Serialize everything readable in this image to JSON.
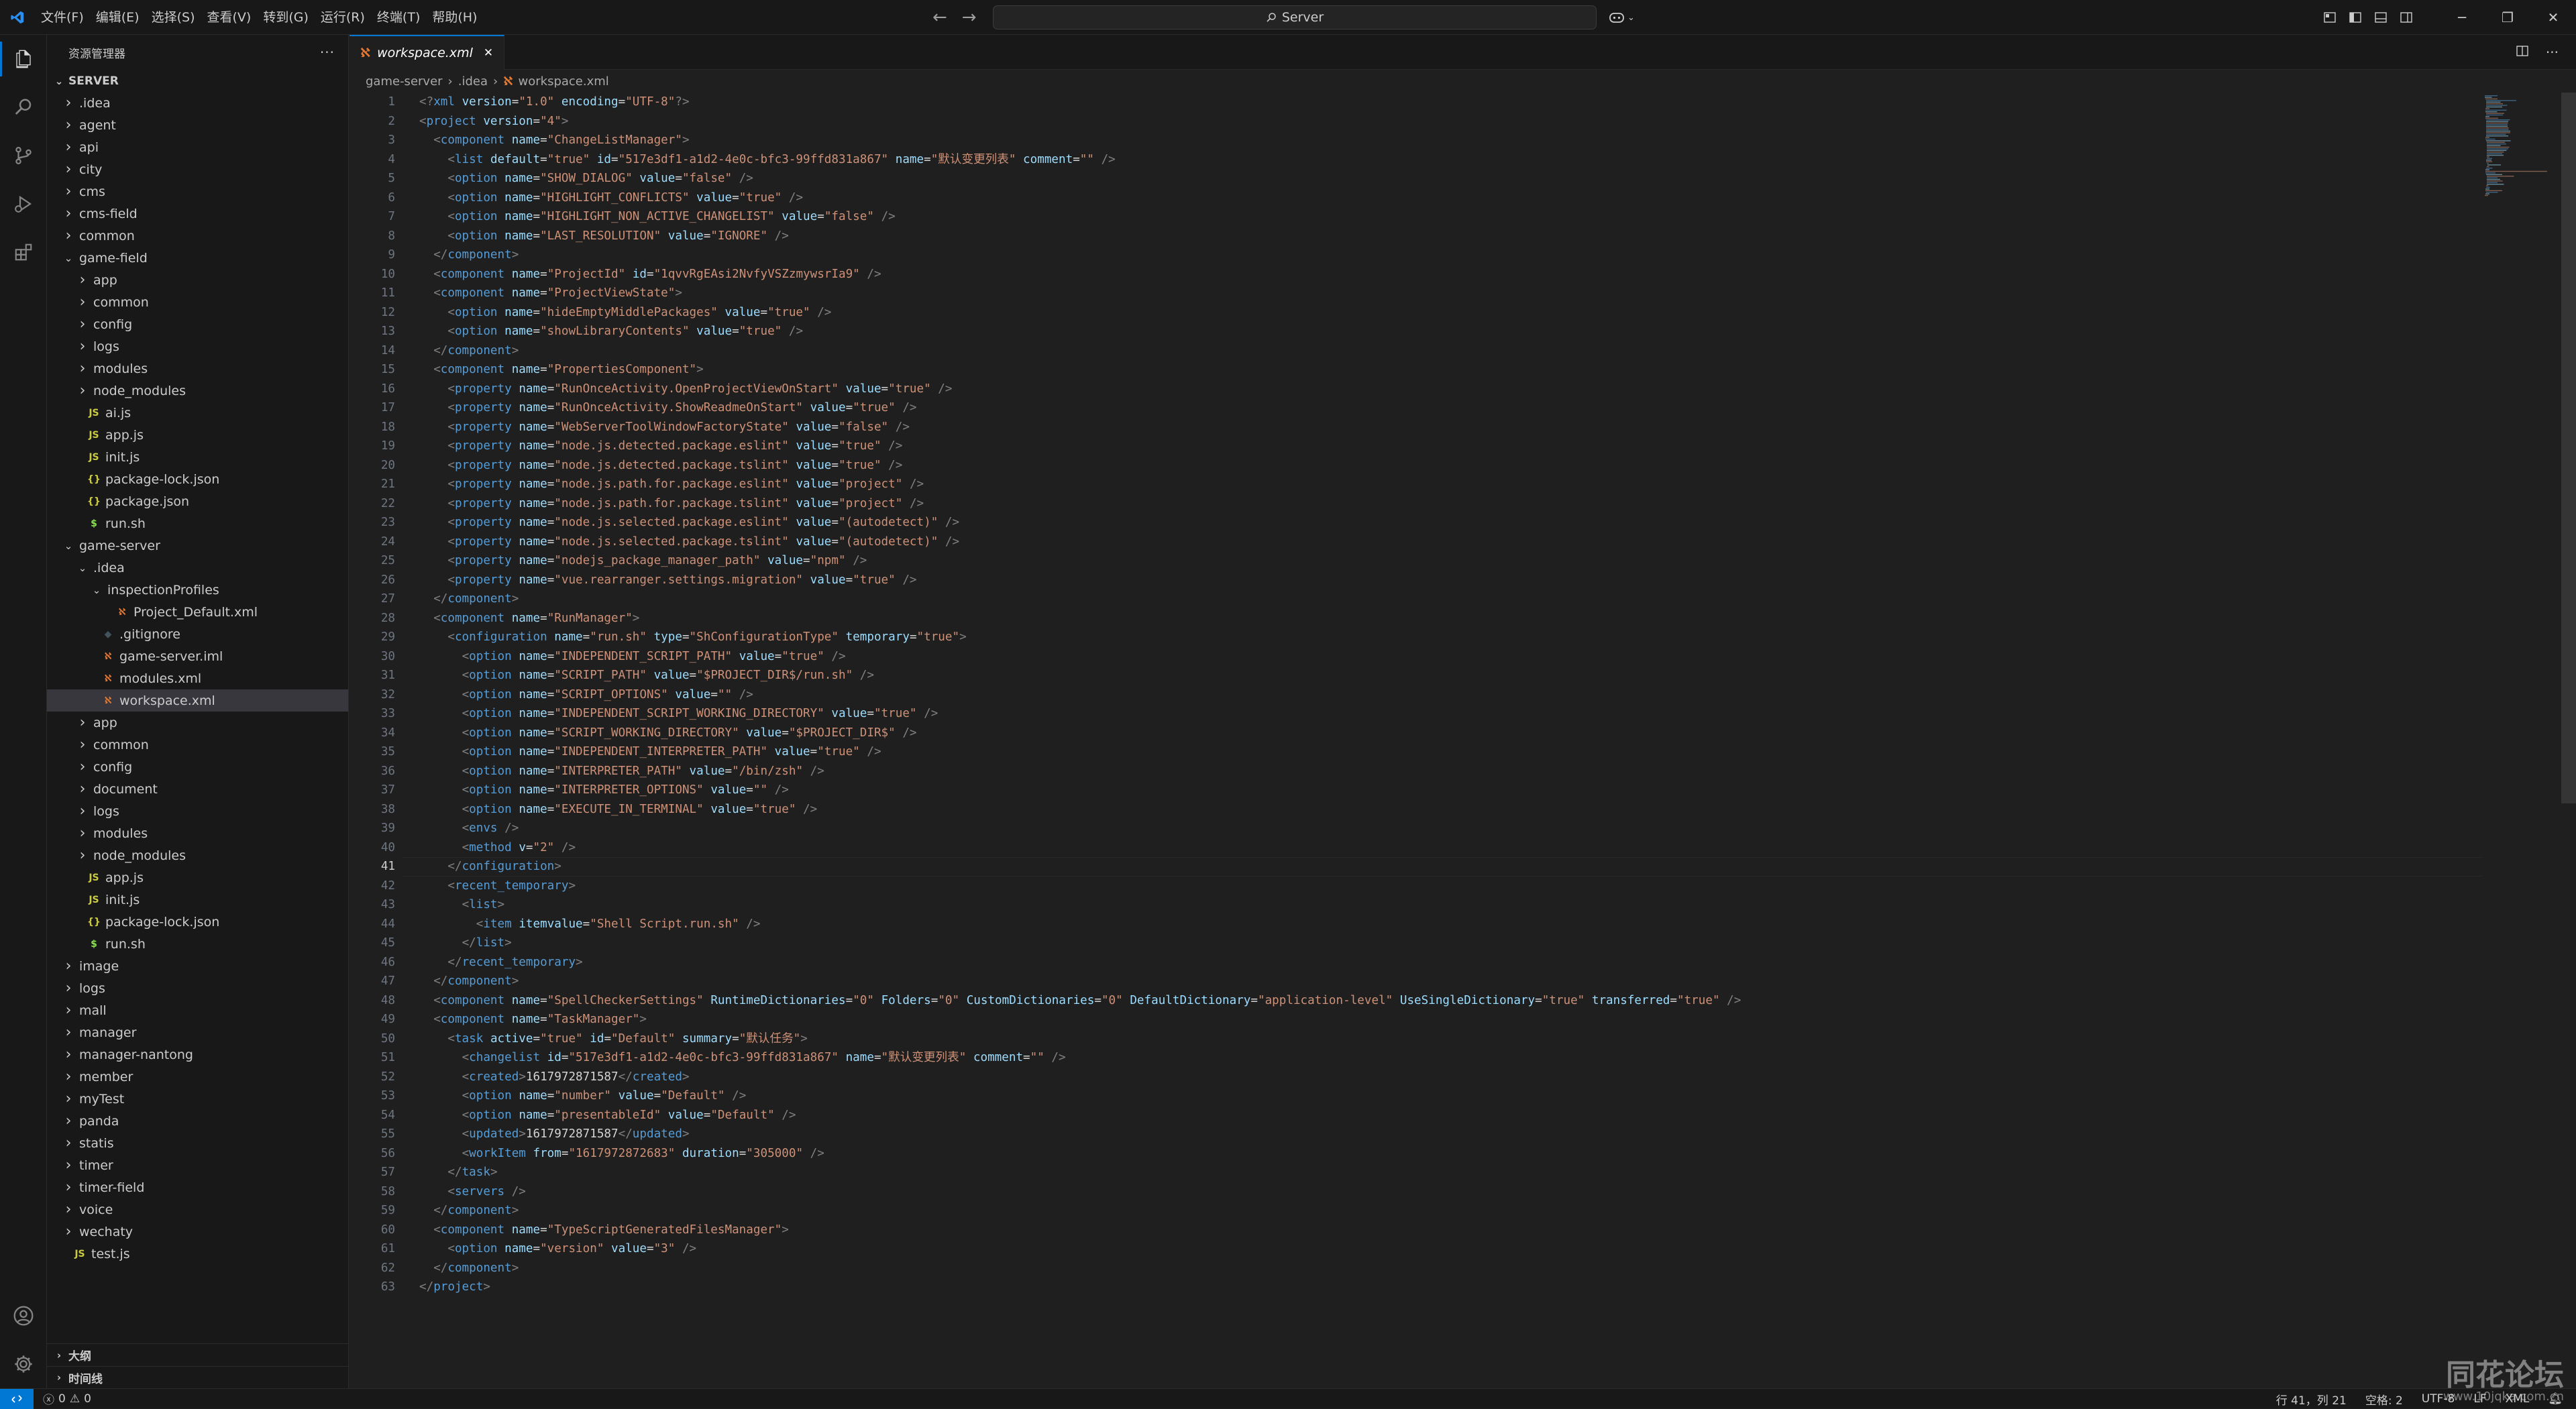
{
  "menu": [
    "文件(F)",
    "编辑(E)",
    "选择(S)",
    "查看(V)",
    "转到(G)",
    "运行(R)",
    "终端(T)",
    "帮助(H)"
  ],
  "search": {
    "text": "Server"
  },
  "sidebar": {
    "title": "资源管理器",
    "root": "SERVER",
    "items": [
      {
        "depth": 0,
        "type": "folder",
        "open": false,
        "label": ".idea"
      },
      {
        "depth": 0,
        "type": "folder",
        "open": false,
        "label": "agent"
      },
      {
        "depth": 0,
        "type": "folder",
        "open": false,
        "label": "api"
      },
      {
        "depth": 0,
        "type": "folder",
        "open": false,
        "label": "city"
      },
      {
        "depth": 0,
        "type": "folder",
        "open": false,
        "label": "cms"
      },
      {
        "depth": 0,
        "type": "folder",
        "open": false,
        "label": "cms-field"
      },
      {
        "depth": 0,
        "type": "folder",
        "open": false,
        "label": "common"
      },
      {
        "depth": 0,
        "type": "folder",
        "open": true,
        "label": "game-field"
      },
      {
        "depth": 1,
        "type": "folder",
        "open": false,
        "label": "app"
      },
      {
        "depth": 1,
        "type": "folder",
        "open": false,
        "label": "common"
      },
      {
        "depth": 1,
        "type": "folder",
        "open": false,
        "label": "config"
      },
      {
        "depth": 1,
        "type": "folder",
        "open": false,
        "label": "logs"
      },
      {
        "depth": 1,
        "type": "folder",
        "open": false,
        "label": "modules"
      },
      {
        "depth": 1,
        "type": "folder",
        "open": false,
        "label": "node_modules"
      },
      {
        "depth": 1,
        "type": "js",
        "label": "ai.js"
      },
      {
        "depth": 1,
        "type": "js",
        "label": "app.js"
      },
      {
        "depth": 1,
        "type": "js",
        "label": "init.js"
      },
      {
        "depth": 1,
        "type": "json",
        "label": "package-lock.json"
      },
      {
        "depth": 1,
        "type": "json",
        "label": "package.json"
      },
      {
        "depth": 1,
        "type": "sh",
        "label": "run.sh"
      },
      {
        "depth": 0,
        "type": "folder",
        "open": true,
        "label": "game-server"
      },
      {
        "depth": 1,
        "type": "folder",
        "open": true,
        "label": ".idea"
      },
      {
        "depth": 2,
        "type": "folder",
        "open": true,
        "label": "inspectionProfiles"
      },
      {
        "depth": 3,
        "type": "xml",
        "label": "Project_Default.xml"
      },
      {
        "depth": 2,
        "type": "git",
        "label": ".gitignore"
      },
      {
        "depth": 2,
        "type": "xml",
        "label": "game-server.iml"
      },
      {
        "depth": 2,
        "type": "xml",
        "label": "modules.xml"
      },
      {
        "depth": 2,
        "type": "xml",
        "label": "workspace.xml",
        "selected": true
      },
      {
        "depth": 1,
        "type": "folder",
        "open": false,
        "label": "app"
      },
      {
        "depth": 1,
        "type": "folder",
        "open": false,
        "label": "common"
      },
      {
        "depth": 1,
        "type": "folder",
        "open": false,
        "label": "config"
      },
      {
        "depth": 1,
        "type": "folder",
        "open": false,
        "label": "document"
      },
      {
        "depth": 1,
        "type": "folder",
        "open": false,
        "label": "logs"
      },
      {
        "depth": 1,
        "type": "folder",
        "open": false,
        "label": "modules"
      },
      {
        "depth": 1,
        "type": "folder",
        "open": false,
        "label": "node_modules"
      },
      {
        "depth": 1,
        "type": "js",
        "label": "app.js"
      },
      {
        "depth": 1,
        "type": "js",
        "label": "init.js"
      },
      {
        "depth": 1,
        "type": "json",
        "label": "package-lock.json"
      },
      {
        "depth": 1,
        "type": "sh",
        "label": "run.sh"
      },
      {
        "depth": 0,
        "type": "folder",
        "open": false,
        "label": "image"
      },
      {
        "depth": 0,
        "type": "folder",
        "open": false,
        "label": "logs"
      },
      {
        "depth": 0,
        "type": "folder",
        "open": false,
        "label": "mall"
      },
      {
        "depth": 0,
        "type": "folder",
        "open": false,
        "label": "manager"
      },
      {
        "depth": 0,
        "type": "folder",
        "open": false,
        "label": "manager-nantong"
      },
      {
        "depth": 0,
        "type": "folder",
        "open": false,
        "label": "member"
      },
      {
        "depth": 0,
        "type": "folder",
        "open": false,
        "label": "myTest"
      },
      {
        "depth": 0,
        "type": "folder",
        "open": false,
        "label": "panda"
      },
      {
        "depth": 0,
        "type": "folder",
        "open": false,
        "label": "statis"
      },
      {
        "depth": 0,
        "type": "folder",
        "open": false,
        "label": "timer"
      },
      {
        "depth": 0,
        "type": "folder",
        "open": false,
        "label": "timer-field"
      },
      {
        "depth": 0,
        "type": "folder",
        "open": false,
        "label": "voice"
      },
      {
        "depth": 0,
        "type": "folder",
        "open": false,
        "label": "wechaty"
      },
      {
        "depth": 0,
        "type": "js",
        "label": "test.js"
      }
    ],
    "outline_label": "大纲",
    "timeline_label": "时间线"
  },
  "tab": {
    "label": "workspace.xml"
  },
  "breadcrumb": [
    "game-server",
    ".idea",
    "workspace.xml"
  ],
  "editor": {
    "cursor_line": 41,
    "lines": [
      "<?xml version=\"1.0\" encoding=\"UTF-8\"?>",
      "<project version=\"4\">",
      "  <component name=\"ChangeListManager\">",
      "    <list default=\"true\" id=\"517e3df1-a1d2-4e0c-bfc3-99ffd831a867\" name=\"默认变更列表\" comment=\"\" />",
      "    <option name=\"SHOW_DIALOG\" value=\"false\" />",
      "    <option name=\"HIGHLIGHT_CONFLICTS\" value=\"true\" />",
      "    <option name=\"HIGHLIGHT_NON_ACTIVE_CHANGELIST\" value=\"false\" />",
      "    <option name=\"LAST_RESOLUTION\" value=\"IGNORE\" />",
      "  </component>",
      "  <component name=\"ProjectId\" id=\"1qvvRgEAsi2NvfyVSZzmywsrIa9\" />",
      "  <component name=\"ProjectViewState\">",
      "    <option name=\"hideEmptyMiddlePackages\" value=\"true\" />",
      "    <option name=\"showLibraryContents\" value=\"true\" />",
      "  </component>",
      "  <component name=\"PropertiesComponent\">",
      "    <property name=\"RunOnceActivity.OpenProjectViewOnStart\" value=\"true\" />",
      "    <property name=\"RunOnceActivity.ShowReadmeOnStart\" value=\"true\" />",
      "    <property name=\"WebServerToolWindowFactoryState\" value=\"false\" />",
      "    <property name=\"node.js.detected.package.eslint\" value=\"true\" />",
      "    <property name=\"node.js.detected.package.tslint\" value=\"true\" />",
      "    <property name=\"node.js.path.for.package.eslint\" value=\"project\" />",
      "    <property name=\"node.js.path.for.package.tslint\" value=\"project\" />",
      "    <property name=\"node.js.selected.package.eslint\" value=\"(autodetect)\" />",
      "    <property name=\"node.js.selected.package.tslint\" value=\"(autodetect)\" />",
      "    <property name=\"nodejs_package_manager_path\" value=\"npm\" />",
      "    <property name=\"vue.rearranger.settings.migration\" value=\"true\" />",
      "  </component>",
      "  <component name=\"RunManager\">",
      "    <configuration name=\"run.sh\" type=\"ShConfigurationType\" temporary=\"true\">",
      "      <option name=\"INDEPENDENT_SCRIPT_PATH\" value=\"true\" />",
      "      <option name=\"SCRIPT_PATH\" value=\"$PROJECT_DIR$/run.sh\" />",
      "      <option name=\"SCRIPT_OPTIONS\" value=\"\" />",
      "      <option name=\"INDEPENDENT_SCRIPT_WORKING_DIRECTORY\" value=\"true\" />",
      "      <option name=\"SCRIPT_WORKING_DIRECTORY\" value=\"$PROJECT_DIR$\" />",
      "      <option name=\"INDEPENDENT_INTERPRETER_PATH\" value=\"true\" />",
      "      <option name=\"INTERPRETER_PATH\" value=\"/bin/zsh\" />",
      "      <option name=\"INTERPRETER_OPTIONS\" value=\"\" />",
      "      <option name=\"EXECUTE_IN_TERMINAL\" value=\"true\" />",
      "      <envs />",
      "      <method v=\"2\" />",
      "    </configuration>",
      "    <recent_temporary>",
      "      <list>",
      "        <item itemvalue=\"Shell Script.run.sh\" />",
      "      </list>",
      "    </recent_temporary>",
      "  </component>",
      "  <component name=\"SpellCheckerSettings\" RuntimeDictionaries=\"0\" Folders=\"0\" CustomDictionaries=\"0\" DefaultDictionary=\"application-level\" UseSingleDictionary=\"true\" transferred=\"true\" />",
      "  <component name=\"TaskManager\">",
      "    <task active=\"true\" id=\"Default\" summary=\"默认任务\">",
      "      <changelist id=\"517e3df1-a1d2-4e0c-bfc3-99ffd831a867\" name=\"默认变更列表\" comment=\"\" />",
      "      <created>1617972871587</created>",
      "      <option name=\"number\" value=\"Default\" />",
      "      <option name=\"presentableId\" value=\"Default\" />",
      "      <updated>1617972871587</updated>",
      "      <workItem from=\"1617972872683\" duration=\"305000\" />",
      "    </task>",
      "    <servers />",
      "  </component>",
      "  <component name=\"TypeScriptGeneratedFilesManager\">",
      "    <option name=\"version\" value=\"3\" />",
      "  </component>",
      "</project>"
    ]
  },
  "status": {
    "errors": "0",
    "warnings": "0",
    "position": "行 41，列 21",
    "spaces": "空格: 2",
    "encoding": "UTF-8",
    "eol": "LF",
    "language": "XML"
  },
  "watermark": {
    "title": "同花论坛",
    "url": "www.10jqka.com.cn"
  },
  "colors": {
    "accent": "#0078d4",
    "tag": "#569cd6",
    "attr": "#9cdcfe",
    "string": "#ce9178",
    "js": "#cbcb41",
    "xml": "#e37933",
    "json": "#cbcb41"
  }
}
